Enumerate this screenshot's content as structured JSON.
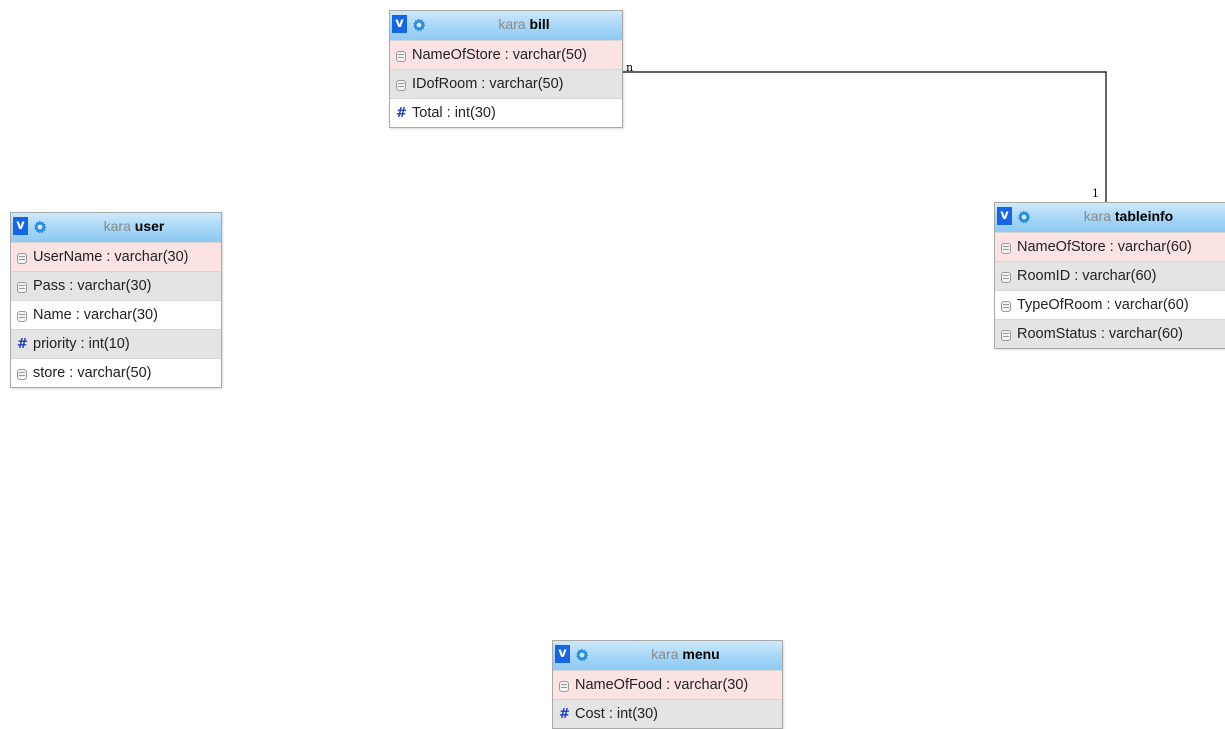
{
  "tables": [
    {
      "id": "bill",
      "db": "kara",
      "name": "bill",
      "columns": [
        {
          "label": "NameOfStore : varchar(50)",
          "kind": "text",
          "pk": true
        },
        {
          "label": "IDofRoom : varchar(50)",
          "kind": "text",
          "pk": false
        },
        {
          "label": "Total : int(30)",
          "kind": "number",
          "pk": false
        }
      ]
    },
    {
      "id": "user",
      "db": "kara",
      "name": "user",
      "columns": [
        {
          "label": "UserName : varchar(30)",
          "kind": "text",
          "pk": true
        },
        {
          "label": "Pass : varchar(30)",
          "kind": "text",
          "pk": false
        },
        {
          "label": "Name : varchar(30)",
          "kind": "text",
          "pk": false
        },
        {
          "label": "priority : int(10)",
          "kind": "number",
          "pk": false
        },
        {
          "label": "store : varchar(50)",
          "kind": "text",
          "pk": false
        }
      ]
    },
    {
      "id": "tableinfo",
      "db": "kara",
      "name": "tableinfo",
      "columns": [
        {
          "label": "NameOfStore : varchar(60)",
          "kind": "text",
          "pk": true
        },
        {
          "label": "RoomID : varchar(60)",
          "kind": "text",
          "pk": false
        },
        {
          "label": "TypeOfRoom : varchar(60)",
          "kind": "text",
          "pk": false
        },
        {
          "label": "RoomStatus : varchar(60)",
          "kind": "text",
          "pk": false
        }
      ]
    },
    {
      "id": "menu",
      "db": "kara",
      "name": "menu",
      "columns": [
        {
          "label": "NameOfFood : varchar(30)",
          "kind": "text",
          "pk": true
        },
        {
          "label": "Cost : int(30)",
          "kind": "number",
          "pk": false
        }
      ]
    }
  ],
  "relation": {
    "from_table": "bill",
    "to_table": "tableinfo",
    "from_cardinality": "n",
    "to_cardinality": "1"
  },
  "colors": {
    "header_top": "#cfe9fb",
    "header_bottom": "#8ecbf3",
    "toggle": "#1466e6",
    "gear": "#2b8fe0",
    "pk_row": "#fbe3e3",
    "alt_row": "#e4e4e4",
    "number_icon": "#1e3fbf"
  },
  "icons": {
    "toggle": "v",
    "settings": "gear-icon",
    "text_column": "column-icon",
    "numeric_column": "#"
  }
}
